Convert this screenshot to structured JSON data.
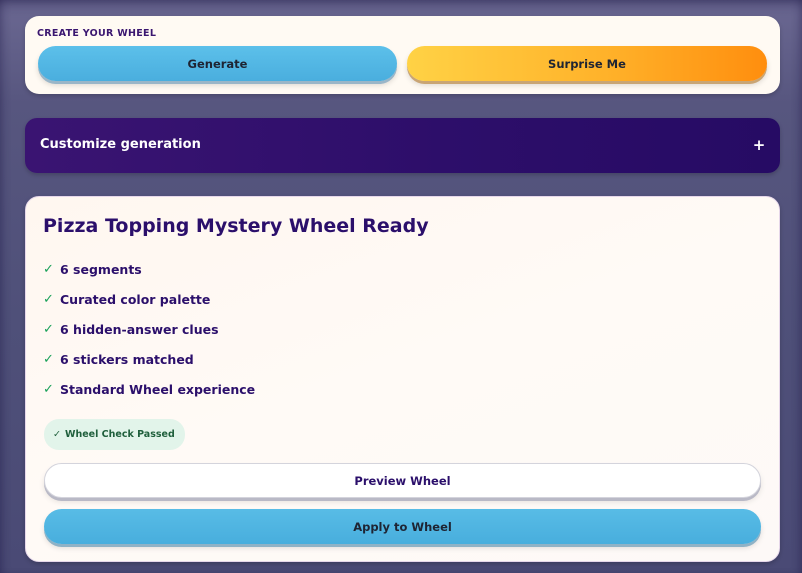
{
  "create_card": {
    "title": "CREATE YOUR WHEEL",
    "generate_label": "Generate",
    "surprise_label": "Surprise Me"
  },
  "customize": {
    "label": "Customize generation",
    "toggle_symbol": "+"
  },
  "result": {
    "title": "Pizza Topping Mystery Wheel Ready",
    "check_symbol": "✓",
    "features": [
      "6 segments",
      "Curated color palette",
      "6 hidden-answer clues",
      "6 stickers matched",
      "Standard Wheel experience"
    ],
    "status_badge": "Wheel Check Passed",
    "preview_label": "Preview Wheel",
    "apply_label": "Apply to Wheel"
  },
  "colors": {
    "accent_blue": "#4aaede",
    "accent_orange": "#ff8e0e",
    "brand_purple": "#2d0e6a",
    "success_green": "#1aa15a"
  },
  "icons": {
    "toggle": "plus-icon",
    "feature": "check-icon"
  }
}
